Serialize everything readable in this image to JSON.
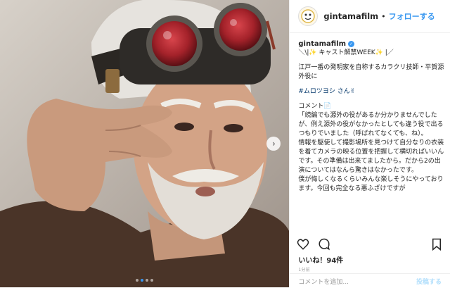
{
  "header": {
    "username": "gintamafilm",
    "separator": "•",
    "follow_label": "フォローする",
    "avatar_icon": "gintama-logo-icon"
  },
  "caption": {
    "username": "gintamafilm",
    "verified_icon": "verified-badge-icon",
    "lines": [
      "＼\\|✨ キャスト解禁WEEK✨ |／",
      "江戸一番の発明家を自称するカラクリ技師・平賀源外役に",
      "#ムロツヨシ さん✌",
      "コメント📄",
      "「続編でも源外の役があるか分かりませんでしたが、例え源外の役がなかったとしても違う役で出るつもりでいました（呼ばれてなくても、ね）。",
      "情報を駆使して撮影場所を見つけて自分なりの衣装を着てカメラの映る位置を把握して横切ればいいんです。その準備は出来てましたから。だから2の出演についてはなんら驚きはなかったです。",
      "僕が悔しくなるくらいみんな楽しそうにやっております。今回も完全なる悪ふざけですが"
    ]
  },
  "actions": {
    "like_icon": "heart-icon",
    "comment_icon": "comment-bubble-icon",
    "save_icon": "bookmark-icon"
  },
  "likes_text": "いいね！94件",
  "timestamp": "1分前",
  "comment_placeholder": "コメントを追加...",
  "post_label": "投稿する",
  "media": {
    "next_icon": "chevron-right-icon",
    "dots": 4,
    "active_dot": 1
  },
  "colors": {
    "accent": "#3897f0",
    "goggle_lens": "#a4222a",
    "tag": "#003569"
  }
}
